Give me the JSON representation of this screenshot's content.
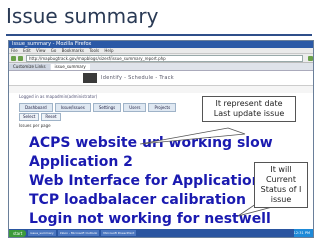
{
  "slide": {
    "title": "Issue summary"
  },
  "browser": {
    "window_title": "Issue_summary - Mozilla Firefox",
    "menu": [
      "File",
      "Edit",
      "View",
      "Go",
      "Bookmarks",
      "Tools",
      "Help"
    ],
    "url": "http://mapbugtrack.gov/mapblogs/sizesf/issue_summary_report.php",
    "tabs": [
      {
        "label": "Customize Links"
      },
      {
        "label": "issue_summary"
      }
    ]
  },
  "app": {
    "title": "Identify - Schedule - Track",
    "logged_in": "Logged in as mapadmin(administrator)",
    "nav": [
      "Dashboard",
      "Issue/Issues",
      "Settings",
      "Users",
      "Projects"
    ],
    "sub_buttons": [
      "Select",
      "Reset"
    ],
    "filter_label": "Issues per page",
    "issues": [
      {
        "title": "ACPS website url working slow"
      },
      {
        "title": "Application 2"
      },
      {
        "title": "Web Interface for Application2"
      },
      {
        "title": "TCP loadbalacer calibration"
      },
      {
        "title": "Login not working for nestwell"
      }
    ]
  },
  "taskbar": {
    "start": "start",
    "items": [
      "issue_summary",
      "Inbox - Microsoft Outlook",
      "Microsoft PowerPoint"
    ],
    "clock": "12:31 PM"
  },
  "callouts": {
    "date": "It represent date Last update issue",
    "status": "It will Current Status of I issue"
  }
}
